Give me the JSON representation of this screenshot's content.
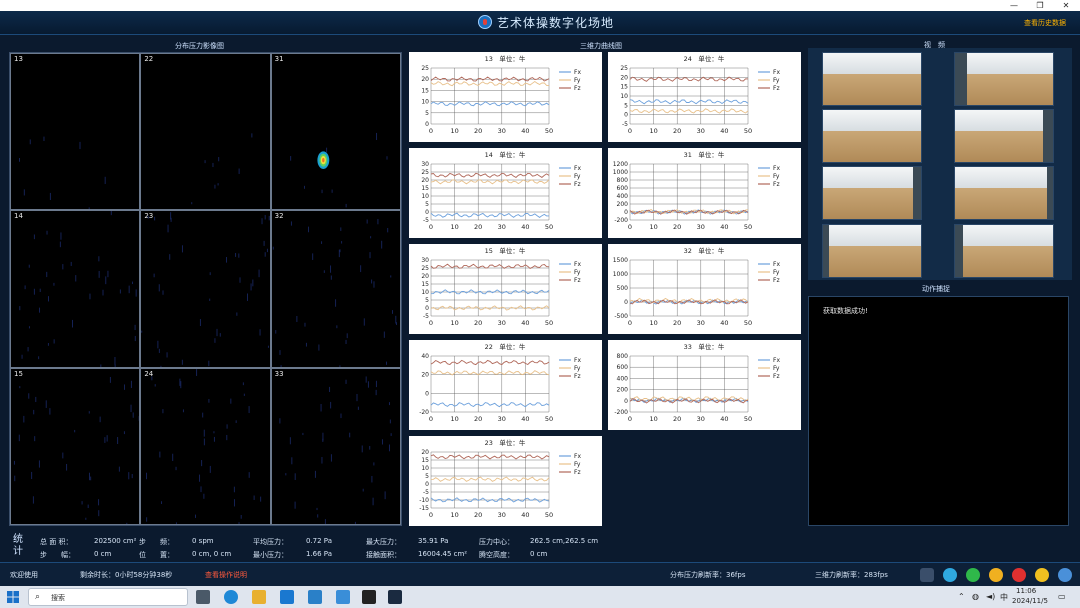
{
  "window": {
    "minimize": "—",
    "maximize": "❐",
    "close": "✕"
  },
  "header": {
    "title": "艺术体操数字化场地",
    "history_link": "查看历史数据"
  },
  "sections": {
    "pressure": "分布压力影像图",
    "curves": "三维力曲线图",
    "video": "视　频",
    "action": "动作捕捉"
  },
  "pressure_cells": [
    "13",
    "22",
    "31",
    "14",
    "23",
    "32",
    "15",
    "24",
    "33"
  ],
  "force_charts": [
    {
      "title": "13　单位：牛",
      "yticks": [
        "25",
        "20",
        "15",
        "10",
        "5",
        "0"
      ],
      "ylim": [
        0,
        25
      ],
      "xticks": [
        "0",
        "10",
        "20",
        "30",
        "40",
        "50"
      ],
      "series": [
        {
          "name": "Fx",
          "color": "#6ca0dc",
          "level": 9
        },
        {
          "name": "Fy",
          "color": "#e8c08a",
          "level": 18
        },
        {
          "name": "Fz",
          "color": "#b0685a",
          "level": 20
        }
      ]
    },
    {
      "title": "24　单位：牛",
      "yticks": [
        "25",
        "20",
        "15",
        "10",
        "5",
        "0",
        "-5"
      ],
      "ylim": [
        -5,
        25
      ],
      "xticks": [
        "0",
        "10",
        "20",
        "30",
        "40",
        "50"
      ],
      "series": [
        {
          "name": "Fx",
          "color": "#6ca0dc",
          "level": 7
        },
        {
          "name": "Fy",
          "color": "#e8c08a",
          "level": 2
        },
        {
          "name": "Fz",
          "color": "#b0685a",
          "level": 19
        }
      ]
    },
    {
      "title": "14　单位：牛",
      "yticks": [
        "30",
        "25",
        "20",
        "15",
        "10",
        "5",
        "0",
        "-5"
      ],
      "ylim": [
        -5,
        30
      ],
      "xticks": [
        "0",
        "10",
        "20",
        "30",
        "40",
        "50"
      ],
      "series": [
        {
          "name": "Fx",
          "color": "#6ca0dc",
          "level": -2
        },
        {
          "name": "Fy",
          "color": "#e8c08a",
          "level": 19
        },
        {
          "name": "Fz",
          "color": "#b0685a",
          "level": 23
        }
      ]
    },
    {
      "title": "31　单位：牛",
      "yticks": [
        "1200",
        "1000",
        "800",
        "600",
        "400",
        "200",
        "0",
        "-200"
      ],
      "ylim": [
        -200,
        1200
      ],
      "xticks": [
        "0",
        "10",
        "20",
        "30",
        "40",
        "50"
      ],
      "series": [
        {
          "name": "Fx",
          "color": "#6ca0dc",
          "level": 0
        },
        {
          "name": "Fy",
          "color": "#e8c08a",
          "level": 10
        },
        {
          "name": "Fz",
          "color": "#b0685a",
          "level": 0
        }
      ]
    },
    {
      "title": "15　单位：牛",
      "yticks": [
        "30",
        "25",
        "20",
        "15",
        "10",
        "5",
        "0",
        "-5"
      ],
      "ylim": [
        -5,
        30
      ],
      "xticks": [
        "0",
        "10",
        "20",
        "30",
        "40",
        "50"
      ],
      "series": [
        {
          "name": "Fx",
          "color": "#6ca0dc",
          "level": 10
        },
        {
          "name": "Fy",
          "color": "#e8c08a",
          "level": 0
        },
        {
          "name": "Fz",
          "color": "#b0685a",
          "level": 26
        }
      ]
    },
    {
      "title": "32　单位：牛",
      "yticks": [
        "1500",
        "1000",
        "500",
        "0",
        "-500"
      ],
      "ylim": [
        -500,
        1500
      ],
      "xticks": [
        "0",
        "10",
        "20",
        "30",
        "40",
        "50"
      ],
      "series": [
        {
          "name": "Fx",
          "color": "#6ca0dc",
          "level": 0
        },
        {
          "name": "Fy",
          "color": "#e8c08a",
          "level": 50
        },
        {
          "name": "Fz",
          "color": "#b0685a",
          "level": 0
        }
      ]
    },
    {
      "title": "22　单位：牛",
      "yticks": [
        "40",
        "20",
        "0",
        "-20"
      ],
      "ylim": [
        -20,
        40
      ],
      "xticks": [
        "0",
        "10",
        "20",
        "30",
        "40",
        "50"
      ],
      "series": [
        {
          "name": "Fx",
          "color": "#6ca0dc",
          "level": -12
        },
        {
          "name": "Fy",
          "color": "#e8c08a",
          "level": 22
        },
        {
          "name": "Fz",
          "color": "#b0685a",
          "level": 33
        }
      ]
    },
    {
      "title": "33　单位：牛",
      "yticks": [
        "800",
        "600",
        "400",
        "200",
        "0",
        "-200"
      ],
      "ylim": [
        -200,
        800
      ],
      "xticks": [
        "0",
        "10",
        "20",
        "30",
        "40",
        "50"
      ],
      "series": [
        {
          "name": "Fx",
          "color": "#6ca0dc",
          "level": 10
        },
        {
          "name": "Fy",
          "color": "#e8c08a",
          "level": 40
        },
        {
          "name": "Fz",
          "color": "#b0685a",
          "level": 0
        }
      ]
    },
    {
      "title": "23　单位：牛",
      "yticks": [
        "20",
        "15",
        "10",
        "5",
        "0",
        "-5",
        "-10",
        "-15"
      ],
      "ylim": [
        -15,
        20
      ],
      "xticks": [
        "0",
        "10",
        "20",
        "30",
        "40",
        "50"
      ],
      "series": [
        {
          "name": "Fx",
          "color": "#6ca0dc",
          "level": -10
        },
        {
          "name": "Fy",
          "color": "#e8c08a",
          "level": 3
        },
        {
          "name": "Fz",
          "color": "#b0685a",
          "level": 17
        }
      ]
    }
  ],
  "action": {
    "message": "获取数据成功!"
  },
  "stats": {
    "heading": "统计",
    "total_area_label": "总 面 积：",
    "total_area_value": "202500 cm²",
    "step_freq_label": "步　　频：",
    "step_freq_value": "0 spm",
    "avg_pressure_label": "平均压力：",
    "avg_pressure_value": "0.72 Pa",
    "max_pressure_label": "最大压力：",
    "max_pressure_value": "35.91 Pa",
    "pressure_center_label": "压力中心：",
    "pressure_center_value": "262.5 cm,262.5 cm",
    "stride_label": "步　　幅：",
    "stride_value": "0 cm",
    "position_label": "位　　置：",
    "position_value": "0 cm, 0 cm",
    "min_pressure_label": "最小压力：",
    "min_pressure_value": "1.66 Pa",
    "contact_area_label": "接触面积：",
    "contact_area_value": "16004.45 cm²",
    "air_height_label": "腾空高度：",
    "air_height_value": "0 cm"
  },
  "status": {
    "welcome": "欢迎使用",
    "remaining": "剩余时长：0小时58分钟38秒",
    "help_link": "查看操作说明",
    "pressure_rate": "分布压力刷新率：36fps",
    "force_rate": "三维力刷新率：283fps"
  },
  "taskbar": {
    "search_placeholder": "搜索",
    "lang": "中",
    "time": "11:06",
    "date": "2024/11/5"
  }
}
